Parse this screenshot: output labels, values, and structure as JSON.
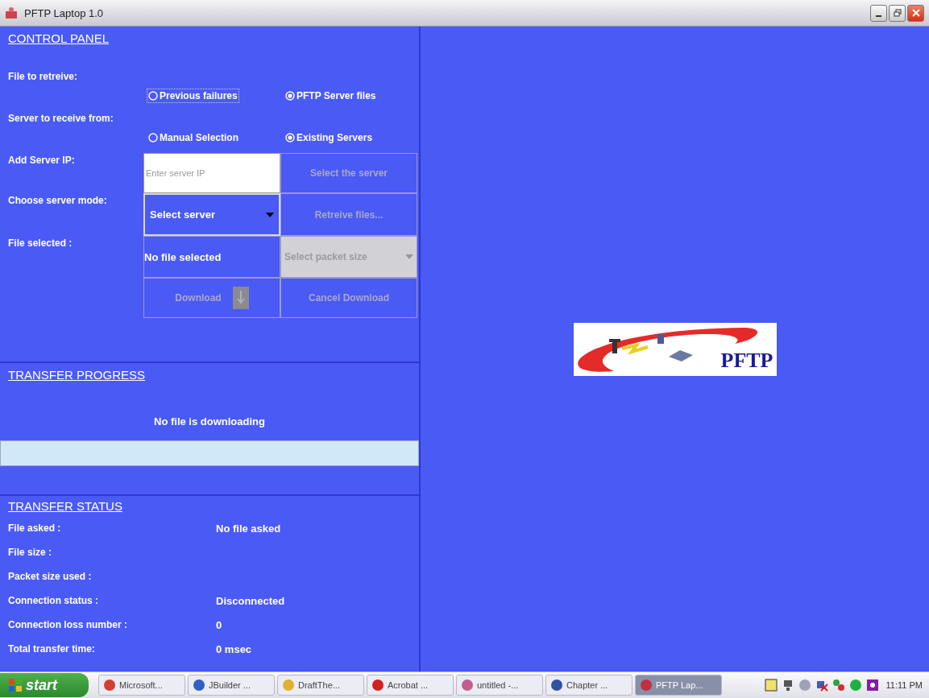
{
  "window": {
    "title": "PFTP Laptop 1.0"
  },
  "control_panel": {
    "title": "CONTROL PANEL",
    "radio_groups": [
      {
        "label": "File to retreive:",
        "options": [
          {
            "label": "Previous failures",
            "selected": false,
            "focused": true
          },
          {
            "label": "PFTP Server files",
            "selected": true,
            "focused": false
          }
        ]
      },
      {
        "label": "Server to receive from:",
        "options": [
          {
            "label": "Manual Selection",
            "selected": false,
            "focused": false
          },
          {
            "label": "Existing Servers",
            "selected": true,
            "focused": false
          }
        ]
      }
    ],
    "server_ip": {
      "label": "Add Server IP:",
      "placeholder": "Enter server IP"
    },
    "select_server_button": {
      "label": "Select the server",
      "disabled": true
    },
    "server_mode": {
      "label": "Choose server mode:",
      "value": "Select server"
    },
    "retrieve_button": {
      "label": "Retreive files...",
      "disabled": true
    },
    "file_selected": {
      "label": "File selected :",
      "value": "No file selected"
    },
    "packet_size": {
      "value": "Select packet size",
      "disabled": true
    },
    "download_button": {
      "label": "Download",
      "disabled": true
    },
    "cancel_button": {
      "label": "Cancel Download",
      "disabled": true
    }
  },
  "transfer_progress": {
    "title": "TRANSFER PROGRESS",
    "message": "No file is downloading",
    "level": 0
  },
  "transfer_status": {
    "title": "TRANSFER STATUS",
    "rows": [
      {
        "label": "File asked :",
        "value": "No file asked"
      },
      {
        "label": "File size :"
      },
      {
        "label": "Packet size used :"
      },
      {
        "label": "Connection status :",
        "value": "Disconnected"
      },
      {
        "label": "Connection loss number :",
        "value": "0"
      },
      {
        "label": "Total transfer time:",
        "value": "0 msec"
      }
    ]
  },
  "logo": {
    "text": "PFTP"
  },
  "taskbar": {
    "start": "start",
    "tasks": [
      {
        "label": "Microsoft...",
        "selected": false
      },
      {
        "label": "JBuilder ...",
        "selected": false
      },
      {
        "label": "DraftThe...",
        "selected": false
      },
      {
        "label": "Acrobat ...",
        "selected": false
      },
      {
        "label": "untitled -...",
        "selected": false
      },
      {
        "label": "Chapter ...",
        "selected": false
      },
      {
        "label": "PFTP Lap...",
        "selected": true
      }
    ],
    "clock": "11:11 PM"
  }
}
